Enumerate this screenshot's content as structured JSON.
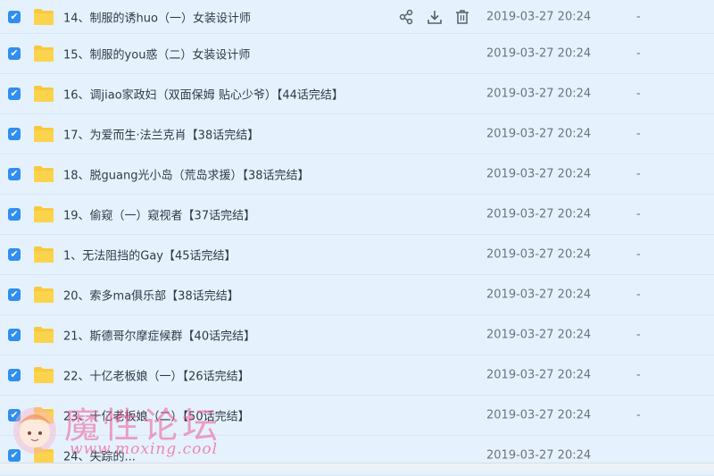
{
  "files": [
    {
      "name": "14、制服的诱huo（一）女装设计师",
      "time": "2019-03-27 20:24",
      "size": "-"
    },
    {
      "name": "15、制服的you惑（二）女装设计师",
      "time": "2019-03-27 20:24",
      "size": "-"
    },
    {
      "name": "16、调jiao家政妇（双面保姆 贴心少爷）【44话完结】",
      "time": "2019-03-27 20:24",
      "size": "-"
    },
    {
      "name": "17、为爱而生·法兰克肖【38话完结】",
      "time": "2019-03-27 20:24",
      "size": "-"
    },
    {
      "name": "18、脱guang光小岛（荒岛求援）【38话完结】",
      "time": "2019-03-27 20:24",
      "size": "-"
    },
    {
      "name": "19、偷窥（一）窥视者【37话完结】",
      "time": "2019-03-27 20:24",
      "size": "-"
    },
    {
      "name": "1、无法阻挡的Gay【45话完结】",
      "time": "2019-03-27 20:24",
      "size": "-"
    },
    {
      "name": "20、索多ma俱乐部【38话完结】",
      "time": "2019-03-27 20:24",
      "size": "-"
    },
    {
      "name": "21、斯德哥尔摩症候群【40话完结】",
      "time": "2019-03-27 20:24",
      "size": "-"
    },
    {
      "name": "22、十亿老板娘（一）【26话完结】",
      "time": "2019-03-27 20:24",
      "size": "-"
    },
    {
      "name": "23、十亿老板娘（二）【50话完结】",
      "time": "2019-03-27 20:24",
      "size": "-"
    },
    {
      "name": "24、失踪的...",
      "time": "2019-03-27 20:24",
      "size": ""
    }
  ],
  "check_mark": "✔",
  "row_icons": [
    "share-icon",
    "download-icon",
    "delete-icon"
  ],
  "watermark": {
    "title": "魔性论坛",
    "url": "www.moxing.cool"
  },
  "colors": {
    "selected_row": "#e5f2fd",
    "checkbox": "#2f8ef0",
    "folder": "#f9c93c",
    "icon": "#555f6a"
  }
}
